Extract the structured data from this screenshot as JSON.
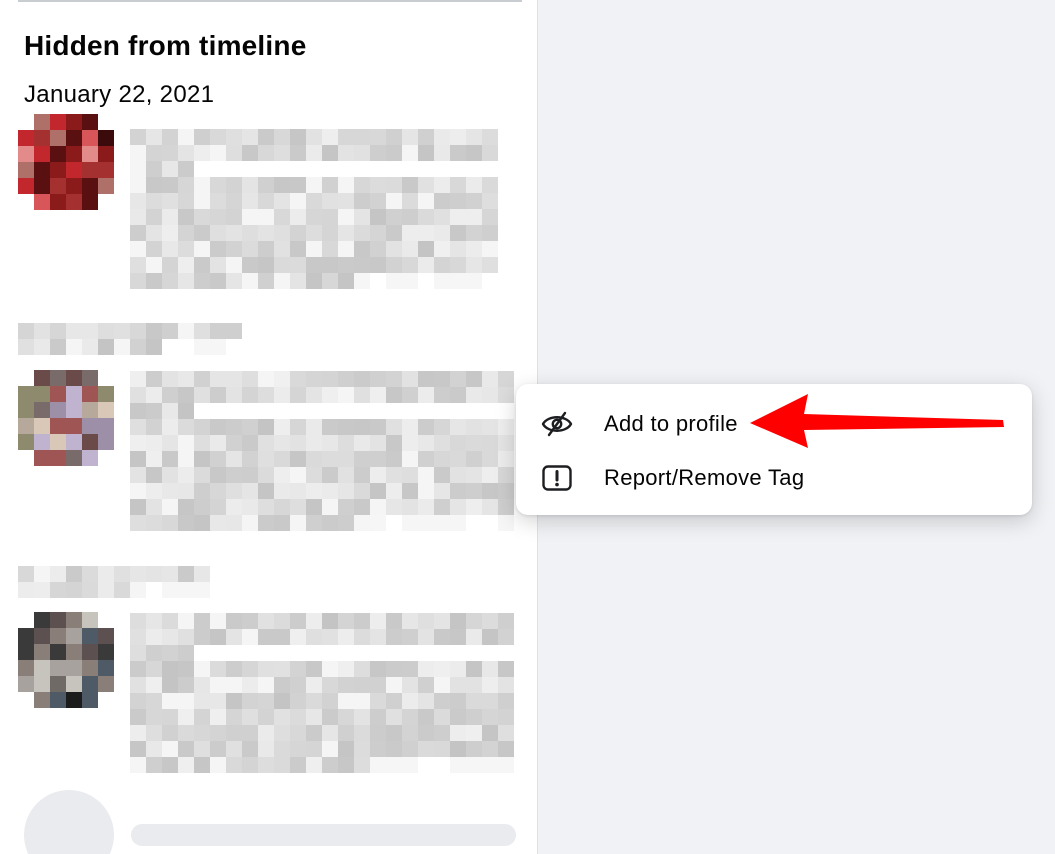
{
  "section": {
    "title": "Hidden from timeline",
    "date": "January 22, 2021"
  },
  "menu": {
    "items": [
      {
        "label": "Add to profile",
        "icon": "eye-slash-icon"
      },
      {
        "label": "Report/Remove Tag",
        "icon": "alert-square-icon"
      }
    ]
  },
  "colors": {
    "arrow": "#ff0000",
    "panel_bg": "#ffffff",
    "page_bg": "#f0f2f5",
    "skeleton": "#e9ebee"
  }
}
